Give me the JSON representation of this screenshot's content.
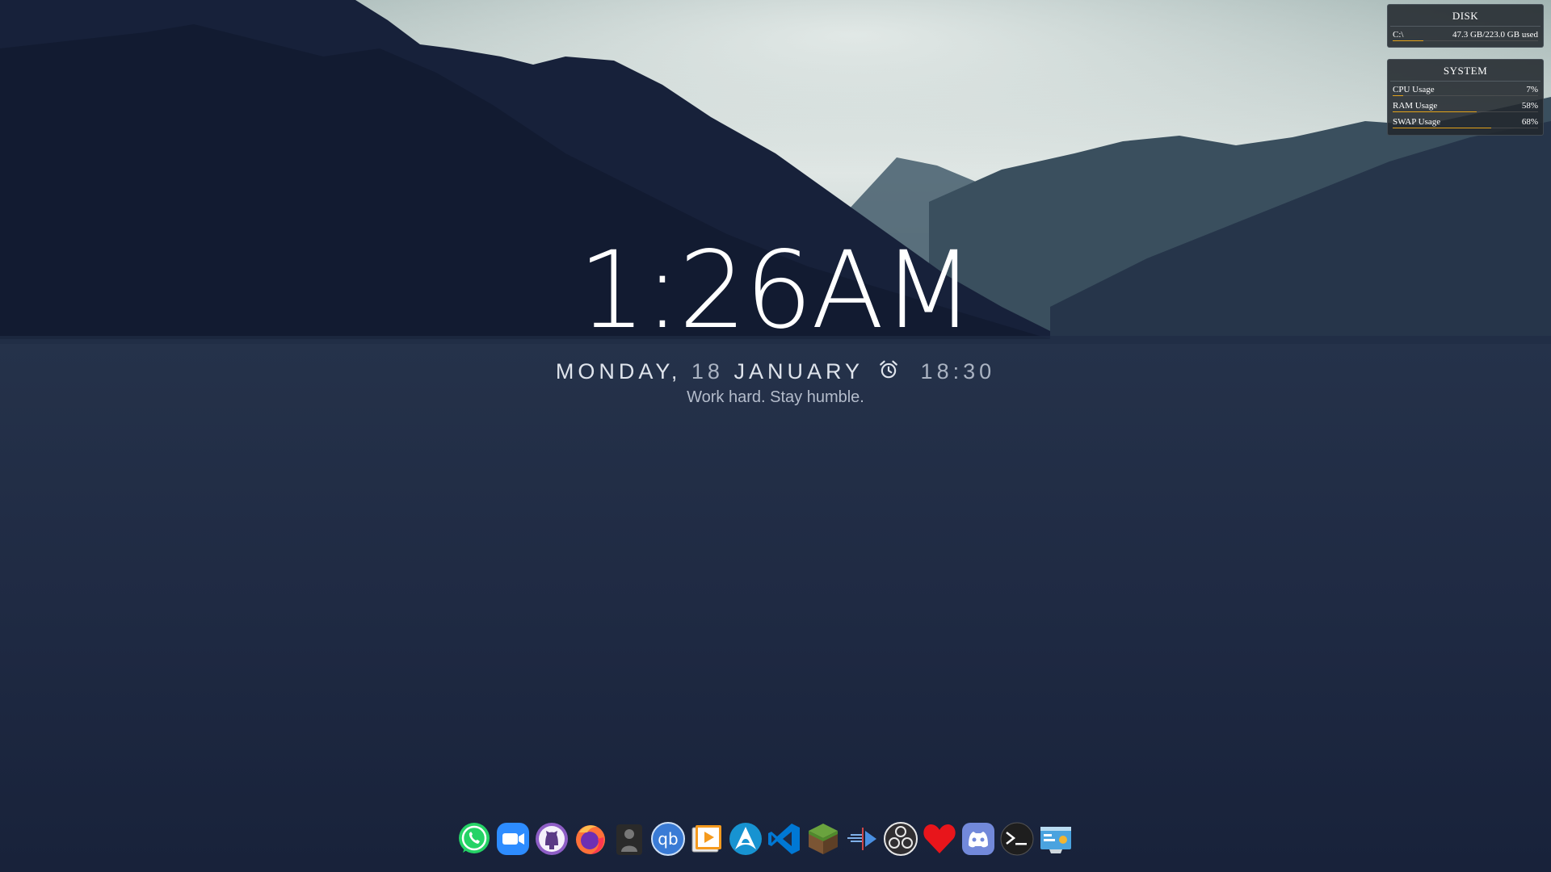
{
  "clock": {
    "time": "1:26AM",
    "weekday": "MONDAY,",
    "day": "18",
    "month": "JANUARY",
    "alarm_time": "18:30",
    "motto": "Work hard. Stay humble."
  },
  "disk_widget": {
    "title": "DISK",
    "drive": "C:\\",
    "usage": "47.3 GB/223.0 GB used",
    "used_fraction": 0.21
  },
  "system_widget": {
    "title": "SYSTEM",
    "rows": [
      {
        "label": "CPU Usage",
        "value": "7%",
        "fraction": 0.07
      },
      {
        "label": "RAM Usage",
        "value": "58%",
        "fraction": 0.58
      },
      {
        "label": "SWAP Usage",
        "value": "68%",
        "fraction": 0.68
      }
    ]
  },
  "dock": {
    "apps": [
      {
        "name": "whatsapp-icon",
        "color": "#25d366"
      },
      {
        "name": "zoom-icon",
        "color": "#2d8cff"
      },
      {
        "name": "github-icon",
        "color": "#8e5ec6"
      },
      {
        "name": "firefox-icon",
        "color": "#ff7139"
      },
      {
        "name": "user-silhouette-icon",
        "color": "#2a2a2a"
      },
      {
        "name": "qbittorrent-icon",
        "color": "#3a7bd5"
      },
      {
        "name": "media-player-icon",
        "color": "#f59a1e"
      },
      {
        "name": "arch-linux-icon",
        "color": "#1793d1"
      },
      {
        "name": "vscode-icon",
        "color": "#0078d4"
      },
      {
        "name": "minecraft-icon",
        "color": "#5b8b32"
      },
      {
        "name": "audio-arrow-icon",
        "color": "#4a90e2"
      },
      {
        "name": "obs-icon",
        "color": "#302e31"
      },
      {
        "name": "heart-icon",
        "color": "#e8151b"
      },
      {
        "name": "discord-icon",
        "color": "#7289da"
      },
      {
        "name": "terminal-icon",
        "color": "#1e1e1e"
      },
      {
        "name": "control-panel-icon",
        "color": "#4aa3df"
      }
    ]
  }
}
